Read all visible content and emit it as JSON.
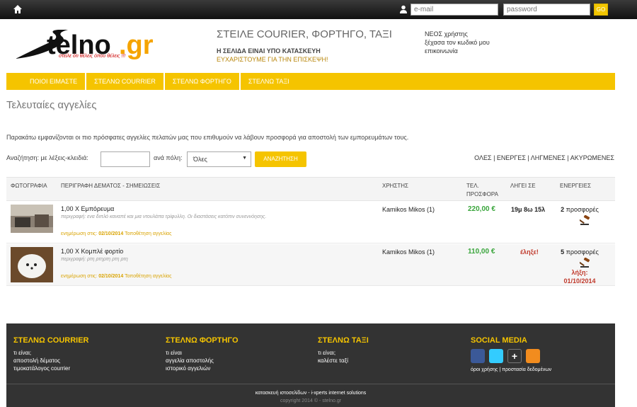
{
  "topbar": {
    "email_placeholder": "e-mail",
    "password_placeholder": "password",
    "go_label": "GO"
  },
  "brand": {
    "logo_text": "Stelno.gr",
    "slogan": "στείλε ότι θέλεις όπου θέλεις !!!"
  },
  "header": {
    "title": "ΣΤΕΙΛΕ COURIER, ΦΟΡΤΗΓΟ, ΤΑΞΙ",
    "line1": "Η ΣΕΛΙΔΑ ΕΙΝΑΙ ΥΠΟ ΚΑΤΑΣΚΕΥΗ",
    "line2": "ΕΥΧΑΡΙΣΤΟΥΜΕ ΓΙΑ ΤΗΝ ΕΠΙΣΚΕΨΗ!"
  },
  "account": {
    "new_user": "ΝΕΟΣ χρήστης",
    "forgot": "ξέχασα τον κωδικό μου",
    "contact": "επικοινωνία"
  },
  "nav": [
    "ΠΟΙΟΙ ΕΙΜΑΣΤΕ",
    "ΣΤΕΛΝΩ COURRIER",
    "ΣΤΕΛΝΩ ΦΟΡΤΗΓΟ",
    "ΣΤΕΛΝΩ ΤΑΞΙ"
  ],
  "page": {
    "title": "Τελευταίες αγγελίες",
    "intro": "Παρακάτω εμφανίζονται οι πιο πρόσφατες αγγελίες πελατών μας που επιθυμούν να λάβουν προσφορά για αποστολή των εμπορευμάτων τους."
  },
  "search": {
    "label": "Αναζήτηση: με λέξεις-κλειδιά:",
    "city_label": "ανά πόλη:",
    "city_value": "Όλες",
    "button": "ΑΝΑΖΗΤΗΣΗ"
  },
  "filters": [
    "ΟΛΕΣ",
    "ΕΝΕΡΓΕΣ",
    "ΛΗΓΜΕΝΕΣ",
    "ΑΚΥΡΩΜΕΝΕΣ"
  ],
  "table": {
    "headers": {
      "photo": "ΦΩΤΟΓΡΑΦΙΑ",
      "desc": "ΠΕΡΙΓΡΑΦΗ ΔΕΜΑΤΟΣ - ΣΗΜΕΙΩΣΕΙΣ",
      "user": "ΧΡΗΣΤΗΣ",
      "offer1": "ΤΕΛ.",
      "offer2": "ΠΡΟΣΦΟΡΑ",
      "expires": "ΛΗΓΕΙ ΣΕ",
      "actions": "ΕΝΕΡΓΕΙΕΣ"
    },
    "rows": [
      {
        "title": "1,00 Χ Εμπόρευμα",
        "description": "περιγραφή: ενα διπλό καναπέ και μια ντουλάπα τρίφυλλη. Οι διαστάσεις κατόπιν συνεννόησης.",
        "updated_label": "ενημέρωση στις:",
        "updated": "02/10/2014",
        "place": "Τοποθέτηση αγγελίας",
        "user": "Kamikos Mikos (1)",
        "price": "220,00 €",
        "expires": "19μ 8ω 15λ",
        "offers_count": "2",
        "offers_label": "προσφορές",
        "expired_note": ""
      },
      {
        "title": "1,00 Χ Κομπλέ φορτίο",
        "description": "περιγραφή: ρτη ρτηρτη ρτη ρτη",
        "updated_label": "ενημέρωση στις:",
        "updated": "02/10/2014",
        "place": "Τοποθέτηση αγγελίας",
        "user": "Kamikos Mikos (1)",
        "price": "110,00 €",
        "expires": "έληξε!",
        "offers_count": "5",
        "offers_label": "προσφορές",
        "expired_note": "λήξη:",
        "expired_date": "01/10/2014"
      }
    ]
  },
  "footer": {
    "courier": {
      "title": "ΣΤΕΛΝΩ COURRIER",
      "links": [
        "τι είναι;",
        "αποστολή δέματος",
        "τιμοκατάλογος courrier"
      ]
    },
    "truck": {
      "title": "ΣΤΕΛΝΩ ΦΟΡΤΗΓΟ",
      "links": [
        "τι είναι",
        "αγγελία αποστολής",
        "ιστορικό αγγελιών"
      ]
    },
    "taxi": {
      "title": "ΣΤΕΛΝΩ ΤΑΞΙ",
      "links": [
        "τι είναι;",
        "καλέστε ταξί"
      ]
    },
    "social": {
      "title": "SOCIAL MEDIA",
      "terms": "όροι χρήσης",
      "privacy": "προστασία δεδομένων"
    },
    "credit": "κατασκευή ιστοσελίδων - i-xperts internet solutions",
    "copyright": "copyright 2014 © - stelno.gr"
  },
  "colors": {
    "accent": "#f5c400",
    "price_green": "#39a53b",
    "expired_red": "#c0392b",
    "footer_bg": "#333333"
  },
  "icons": [
    "home-icon",
    "user-icon",
    "gavel-icon",
    "facebook-icon",
    "twitter-icon",
    "googleplus-icon",
    "rss-icon"
  ]
}
